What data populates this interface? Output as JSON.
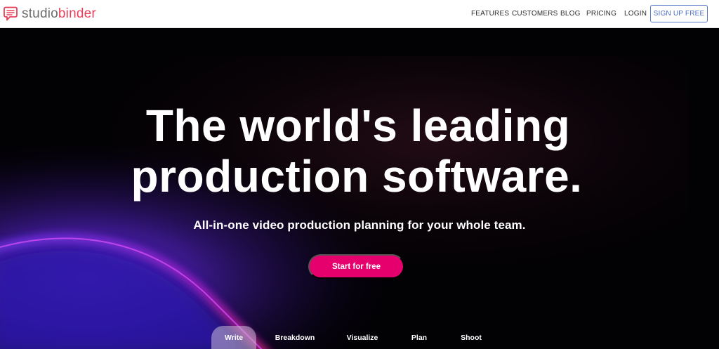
{
  "brand": {
    "name_part1": "studio",
    "name_part2": "binder",
    "logo_icon": "speech-bubble-icon",
    "color_primary": "#e8405a",
    "color_text": "#6b6b6b"
  },
  "nav": {
    "links": [
      "FEATURES",
      "CUSTOMERS",
      "BLOG",
      "PRICING"
    ],
    "login": "LOGIN",
    "signup": "SIGN UP FREE",
    "signup_color": "#4a6bc4"
  },
  "hero": {
    "headline_line1": "The world's leading",
    "headline_line2": "production software.",
    "subheadline": "All-in-one video production planning for your whole team.",
    "cta_label": "Start for free",
    "cta_color": "#e6006d"
  },
  "tabs": {
    "items": [
      "Write",
      "Breakdown",
      "Visualize",
      "Plan",
      "Shoot"
    ],
    "active": "Write"
  }
}
